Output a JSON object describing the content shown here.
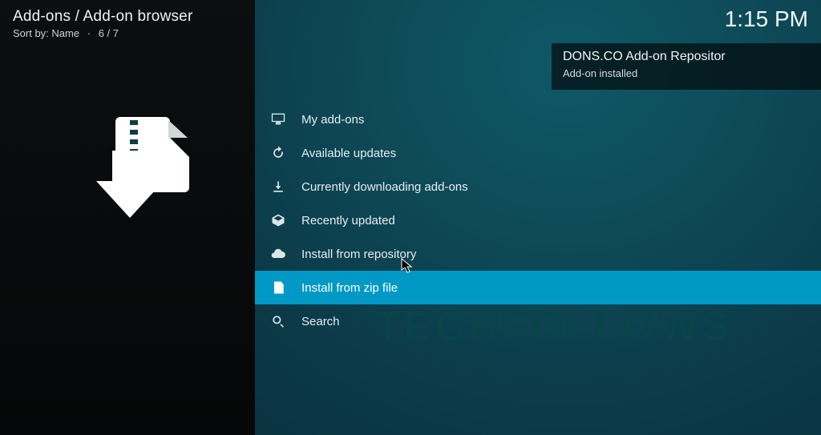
{
  "header": {
    "breadcrumb": "Add-ons / Add-on browser",
    "sort_label": "Sort by: Name",
    "position": "6 / 7",
    "clock": "1:15 PM"
  },
  "toast": {
    "title": "DONS.CO Add-on Repositor",
    "subtitle": "Add-on installed"
  },
  "menu": {
    "items": [
      {
        "icon": "monitor-icon",
        "label": "My add-ons",
        "selected": false
      },
      {
        "icon": "refresh-icon",
        "label": "Available updates",
        "selected": false
      },
      {
        "icon": "download-icon",
        "label": "Currently downloading add-ons",
        "selected": false
      },
      {
        "icon": "box-icon",
        "label": "Recently updated",
        "selected": false
      },
      {
        "icon": "cloud-icon",
        "label": "Install from repository",
        "selected": false
      },
      {
        "icon": "zip-icon",
        "label": "Install from zip file",
        "selected": true
      },
      {
        "icon": "search-icon",
        "label": "Search",
        "selected": false
      }
    ]
  },
  "watermark": "TECHFOLLOWS"
}
